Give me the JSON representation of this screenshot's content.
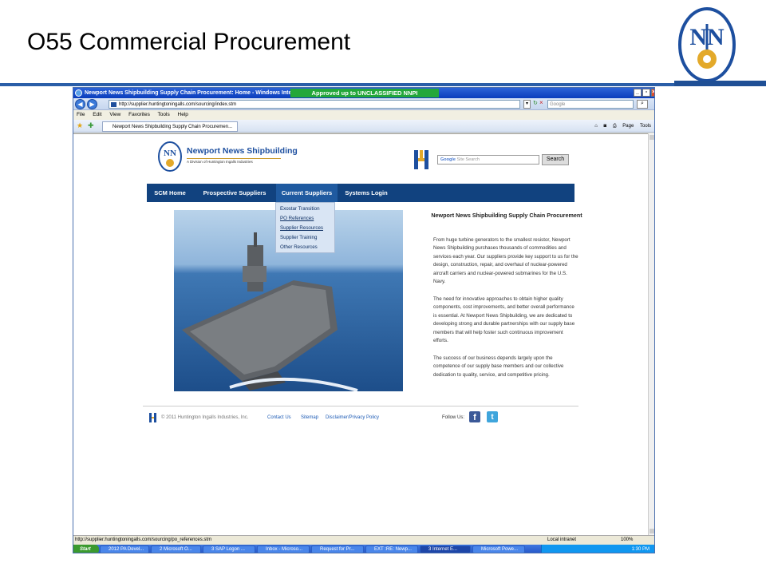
{
  "slide": {
    "title": "O55 Commercial Procurement"
  },
  "browser": {
    "window_title": "Newport News Shipbuilding Supply Chain Procurement: Home - Windows Internet E",
    "classification_banner": "Approved up to UNCLASSIFIED NNPI",
    "url": "http://supplier.huntingtoningalls.com/sourcing/index.stm",
    "search_placeholder": "Google",
    "menu": [
      "File",
      "Edit",
      "View",
      "Favorites",
      "Tools",
      "Help"
    ],
    "tab_title": "Newport News Shipbuilding Supply Chain Procuremen...",
    "commands": [
      "Page",
      "Tools"
    ],
    "status_url": "http://supplier.huntingtoningalls.com/sourcing/po_references.stm",
    "zone": "Local intranet",
    "zoom": "100%"
  },
  "taskbar": {
    "start": "Start",
    "tasks": [
      "2012 PA Devel...",
      "2 Microsoft O...",
      "3 SAP Logon ...",
      "Inbox - Microso...",
      "Request for Pr...",
      "EXT :RE: Newp...",
      "3 Internet E...",
      "Microsoft Powe..."
    ],
    "clock": "1:30 PM"
  },
  "site": {
    "brand": "Newport News Shipbuilding",
    "brand_sub": "A Division of Huntington Ingalls Industries",
    "search_placeholder": "Site Search",
    "search_button": "Search",
    "nav": [
      "SCM Home",
      "Prospective Suppliers",
      "Current Suppliers",
      "Systems Login"
    ],
    "dropdown": [
      "Exostar Transition",
      "PO References",
      "Supplier Resources",
      "Supplier Training",
      "Other Resources"
    ],
    "heading": "Newport News Shipbuilding Supply Chain Procurement",
    "paragraphs": [
      "From huge turbine generators to the smallest resistor, Newport News Shipbuilding purchases thousands of commodities and services each year. Our suppliers provide key support to us for the design, construction, repair, and overhaul of nuclear-powered aircraft carriers and nuclear-powered submarines for the U.S. Navy.",
      "The need for innovative approaches to obtain higher quality components, cost improvements, and better overall performance is essential. At Newport News Shipbuilding, we are dedicated to developing strong and durable partnerships with our supply base members that will help foster such continuous improvement efforts.",
      "The success of our business depends largely upon the competence of our supply base members and our collective dedication to quality, service, and competitive pricing."
    ],
    "footer": {
      "copyright": "© 2011 Huntington Ingalls Industries, Inc.",
      "links": [
        "Contact Us",
        "Sitemap",
        "Disclaimer/Privacy Policy"
      ],
      "follow": "Follow Us:"
    }
  },
  "colors": {
    "nav_bg": "#11427f",
    "brand_blue": "#1d4f9f",
    "banner_green": "#23a73a",
    "slide_rule": "#2a5ea8"
  }
}
